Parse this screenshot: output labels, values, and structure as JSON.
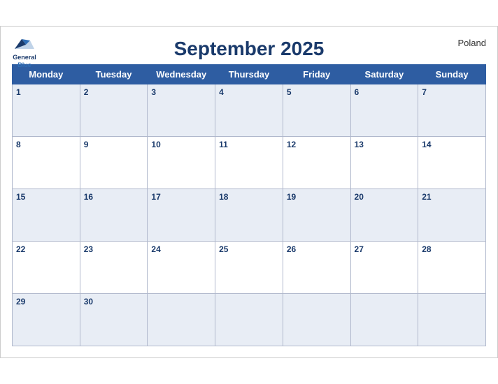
{
  "header": {
    "title": "September 2025",
    "country": "Poland",
    "logo_general": "General",
    "logo_blue": "Blue"
  },
  "weekdays": [
    "Monday",
    "Tuesday",
    "Wednesday",
    "Thursday",
    "Friday",
    "Saturday",
    "Sunday"
  ],
  "weeks": [
    [
      1,
      2,
      3,
      4,
      5,
      6,
      7
    ],
    [
      8,
      9,
      10,
      11,
      12,
      13,
      14
    ],
    [
      15,
      16,
      17,
      18,
      19,
      20,
      21
    ],
    [
      22,
      23,
      24,
      25,
      26,
      27,
      28
    ],
    [
      29,
      30,
      null,
      null,
      null,
      null,
      null
    ]
  ]
}
